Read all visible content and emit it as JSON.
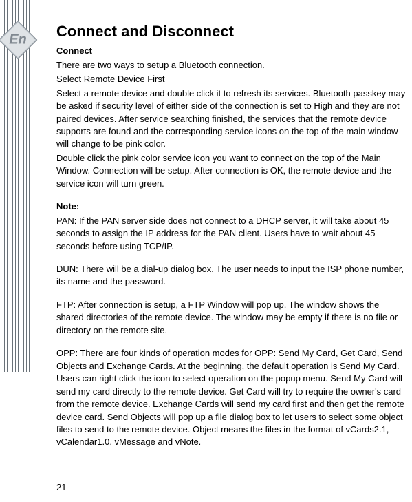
{
  "sidebar": {
    "badge": "En"
  },
  "page": {
    "title": "Connect and Disconnect",
    "subhead": "Connect",
    "p_intro": "There are two ways to setup a Bluetooth connection.",
    "p_select_first": "Select Remote Device First",
    "p_select_body": "Select a remote device and double click it to refresh its services. Bluetooth passkey may be asked if security level of either side of the connection is set to High and they are not paired devices. After service searching finished, the services that the remote device supports are found and the corresponding service icons on the top of the main window will change to be pink color.",
    "p_doubleclick": "Double click the pink color service icon you want to connect on the top of the Main Window. Connection will be setup. After connection is OK, the remote device and the service icon will turn green.",
    "note_label": "Note:",
    "p_pan": "PAN: If the PAN server side does not connect to a DHCP server, it will take about 45 seconds to assign the IP address for the PAN client. Users have to wait about 45 seconds before using TCP/IP.",
    "p_dun": "DUN: There will be a dial-up dialog box. The user needs to input the ISP phone number, its name and the password.",
    "p_ftp": "FTP: After connection is setup, a FTP Window will pop up. The window shows the shared directories of the remote device. The window may be empty if there is no file or directory on the remote site.",
    "p_opp": "OPP: There are four kinds of operation modes for OPP: Send My Card, Get Card, Send Objects and Exchange Cards. At the beginning, the default operation is Send My Card. Users can right click the icon to select operation on the popup menu. Send My Card will send my card directly to the remote device. Get Card will try to require the owner's card from the remote device. Exchange Cards will send my card first and then get the remote device card. Send Objects will pop up a file dialog box to let users to select some object files to send to the remote device. Object means the files in the format of vCards2.1, vCalendar1.0, vMessage and vNote.",
    "number": "21"
  }
}
